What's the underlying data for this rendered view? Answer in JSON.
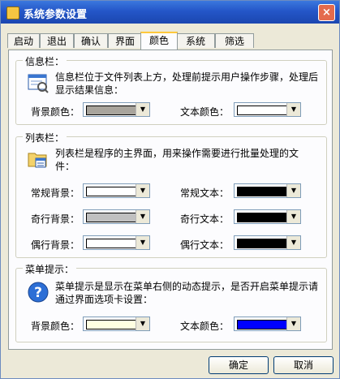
{
  "window": {
    "title": "系统参数设置",
    "close_label": "×"
  },
  "tabs": [
    {
      "label": "启动"
    },
    {
      "label": "退出"
    },
    {
      "label": "确认"
    },
    {
      "label": "界面"
    },
    {
      "label": "颜色"
    },
    {
      "label": "系统"
    },
    {
      "label": "筛选"
    }
  ],
  "info_bar": {
    "legend": "信息栏：",
    "description": "信息栏位于文件列表上方，处理前提示用户操作步骤，处理后显示结果信息：",
    "bg_label": "背景颜色：",
    "bg_color": "#a8a49c",
    "text_label": "文本颜色：",
    "text_color": "#ffffff"
  },
  "list_bar": {
    "legend": "列表栏：",
    "description": "列表栏是程序的主界面，用来操作需要进行批量处理的文件：",
    "rows": [
      {
        "bg_label": "常规背景：",
        "bg_color": "#ffffff",
        "text_label": "常规文本：",
        "text_color": "#000000"
      },
      {
        "bg_label": "奇行背景：",
        "bg_color": "#c0c0c0",
        "text_label": "奇行文本：",
        "text_color": "#000000"
      },
      {
        "bg_label": "偶行背景：",
        "bg_color": "#ffffff",
        "text_label": "偶行文本：",
        "text_color": "#000000"
      }
    ]
  },
  "menu_tip": {
    "legend": "菜单提示：",
    "description": "菜单提示是显示在菜单右侧的动态提示，是否开启菜单提示请通过界面选项卡设置：",
    "bg_label": "背景颜色：",
    "bg_color": "#ffffe1",
    "text_label": "文本颜色：",
    "text_color": "#0000ff"
  },
  "buttons": {
    "ok": "确定",
    "cancel": "取消"
  }
}
